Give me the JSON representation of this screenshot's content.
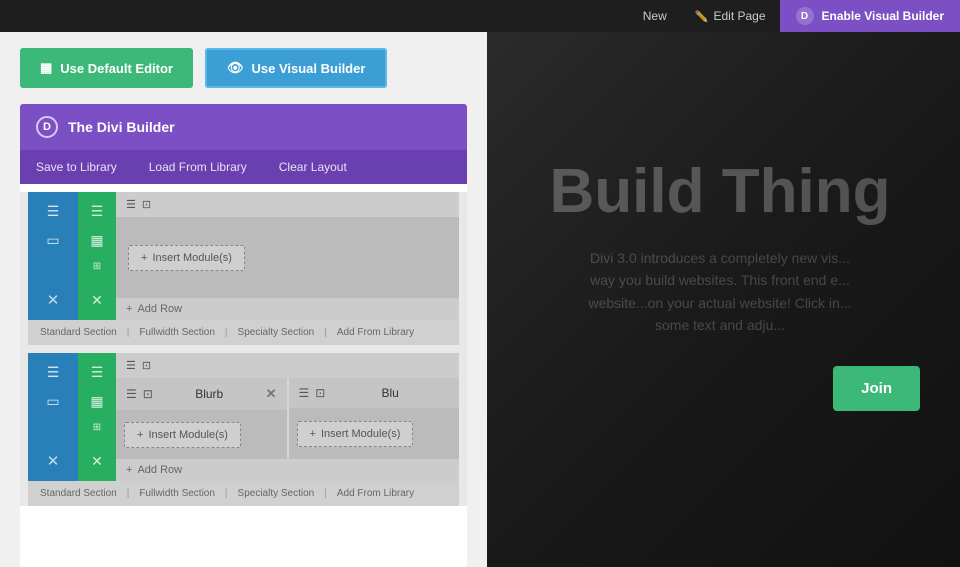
{
  "topbar": {
    "new_label": "New",
    "edit_page_label": "Edit Page",
    "enable_vb_label": "Enable Visual Builder",
    "divi_letter": "D"
  },
  "editor_buttons": {
    "default_editor_label": "Use Default Editor",
    "visual_builder_label": "Use Visual Builder"
  },
  "divi_builder": {
    "logo_letter": "D",
    "title": "The Divi Builder",
    "toolbar": {
      "save_label": "Save to Library",
      "load_label": "Load From Library",
      "clear_label": "Clear Layout"
    }
  },
  "builder_content": {
    "section1": {
      "add_row_label": "Add Row",
      "insert_module_label": "Insert Module(s)",
      "footer_items": [
        "Standard Section",
        "Fullwidth Section",
        "Specialty Section",
        "Add From Library"
      ]
    },
    "section2": {
      "module1_label": "Blurb",
      "module2_label": "Blu",
      "add_row_label": "Add Row",
      "insert_module1_label": "Insert Module(s)",
      "insert_module2_label": "Insert Module(s)",
      "footer_items": [
        "Standard Section",
        "Fullwidth Section",
        "Specialty Section",
        "Add From Library"
      ]
    }
  },
  "hero": {
    "title": "Build Thing",
    "description": "Divi 3.0 introduces a completely new vis... way you build websites. This front end e... website...on your actual website! Click in... some text and adju...",
    "join_label": "Join"
  }
}
